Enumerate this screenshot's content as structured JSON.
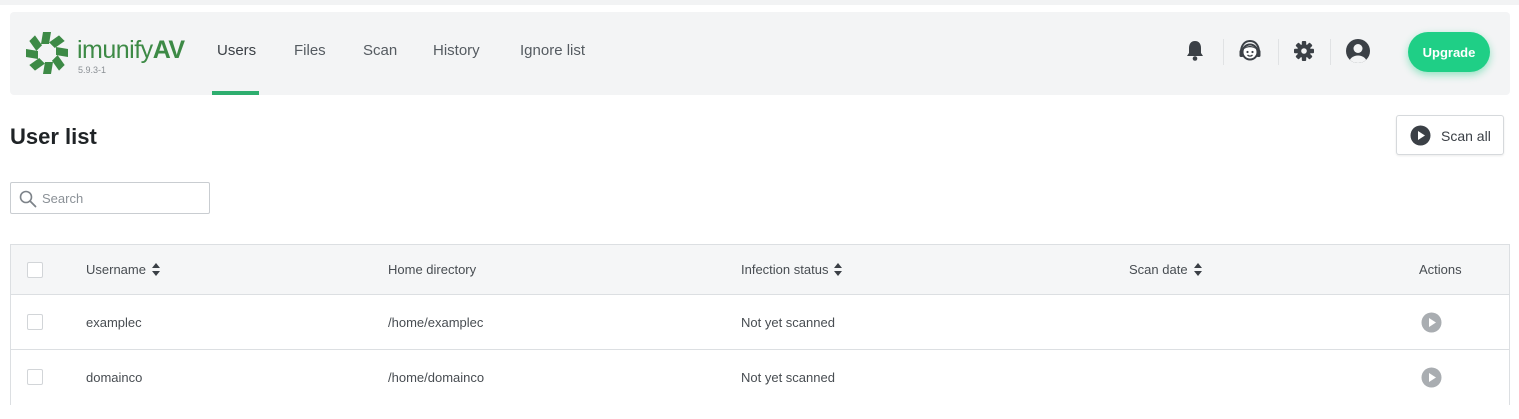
{
  "app": {
    "logo_text_light": "imunify",
    "logo_text_bold": "AV",
    "version": "5.9.3-1"
  },
  "nav": {
    "items": [
      {
        "label": "Users",
        "active": true
      },
      {
        "label": "Files",
        "active": false
      },
      {
        "label": "Scan",
        "active": false
      },
      {
        "label": "History",
        "active": false
      },
      {
        "label": "Ignore list",
        "active": false
      }
    ]
  },
  "header_icons": [
    "bell-icon",
    "support-agent-icon",
    "gear-icon",
    "user-account-icon"
  ],
  "upgrade_label": "Upgrade",
  "page": {
    "title": "User list",
    "scan_all_label": "Scan all"
  },
  "search": {
    "placeholder": "Search",
    "value": ""
  },
  "table": {
    "columns": {
      "username": "Username",
      "home_directory": "Home directory",
      "infection_status": "Infection status",
      "scan_date": "Scan date",
      "actions": "Actions"
    },
    "rows": [
      {
        "username": "examplec",
        "home_directory": "/home/examplec",
        "infection_status": "Not yet scanned",
        "scan_date": ""
      },
      {
        "username": "domainco",
        "home_directory": "/home/domainco",
        "infection_status": "Not yet scanned",
        "scan_date": ""
      }
    ]
  },
  "colors": {
    "brand_green": "#3d8a46",
    "accent_green": "#2eae6f",
    "upgrade_green": "#1fcf86",
    "header_bg": "#f3f4f5",
    "icon_dark": "#3b4046",
    "action_grey": "#a9adb1"
  }
}
